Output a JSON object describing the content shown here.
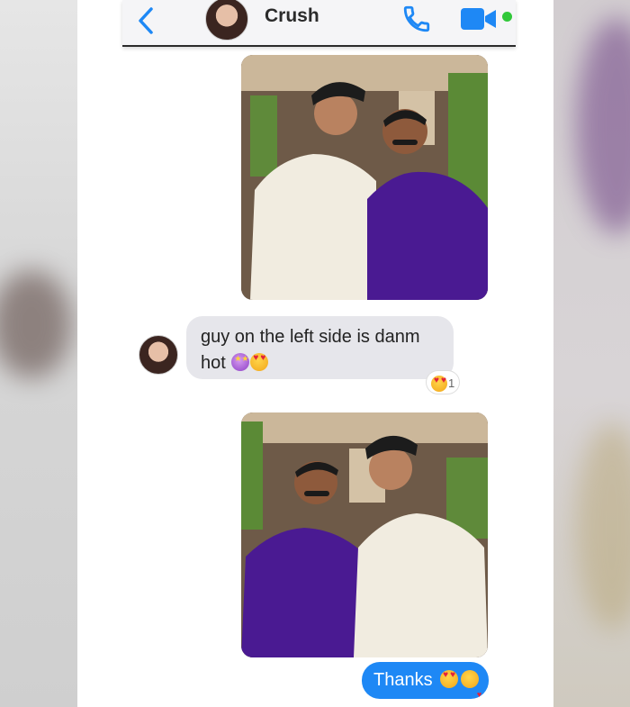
{
  "conversation": {
    "contact_name": "Crush"
  },
  "messages": {
    "incoming_text": "guy on the left side is danm hot",
    "incoming_emojis": [
      "star-struck-emoji",
      "heart-eyes-emoji"
    ],
    "reaction_emoji": "heart-eyes-emoji",
    "reaction_count": "1",
    "outgoing_text": "Thanks",
    "outgoing_emojis": [
      "heart-eyes-emoji",
      "kissing-face-emoji"
    ]
  },
  "colors": {
    "header_bg": "#f5f5f7",
    "accent_blue": "#1e88f5",
    "online_green": "#31c83a",
    "incoming_bubble": "#e6e6eb"
  },
  "icons": [
    "back-chevron-icon",
    "phone-icon",
    "video-camera-icon",
    "online-status-dot"
  ]
}
